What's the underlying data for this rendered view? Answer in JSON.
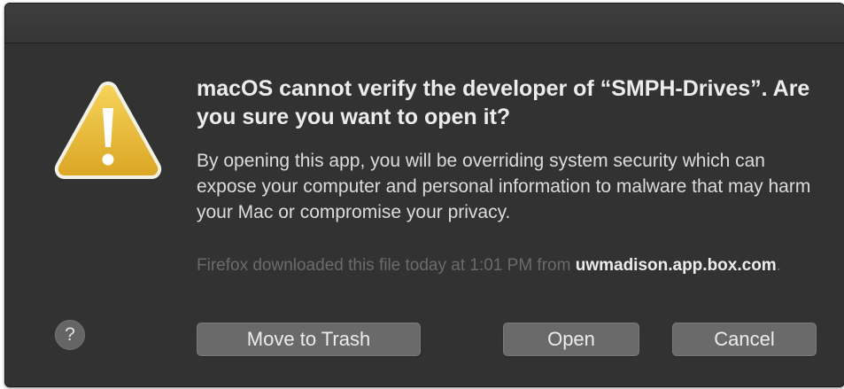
{
  "dialog": {
    "headline": "macOS cannot verify the developer of “SMPH-Drives”. Are you sure you want to open it?",
    "body": "By opening this app, you will be overriding system security which can expose your computer and personal information to malware that may harm your Mac or compromise your privacy.",
    "source_prefix": "Firefox downloaded this file today at 1:01 PM from ",
    "source_domain": "uwmadison.app.box.com",
    "source_suffix": ".",
    "icon": "warning-triangle-icon",
    "help_label": "?",
    "buttons": {
      "trash_label": "Move to Trash",
      "open_label": "Open",
      "cancel_label": "Cancel"
    }
  },
  "colors": {
    "dialog_bg": "#323232",
    "warning_yellow": "#e8b528",
    "button_bg": "#6a6a6a"
  }
}
